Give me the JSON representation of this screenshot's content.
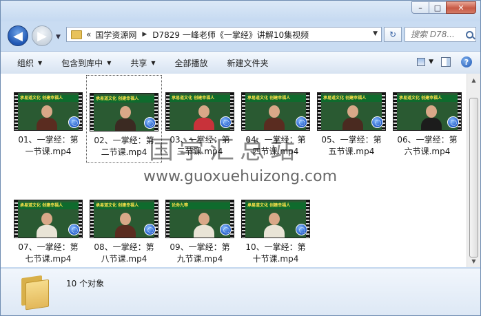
{
  "window": {
    "caption_buttons": {
      "minimize": "–",
      "maximize": "□",
      "close": "✕"
    }
  },
  "navigation": {
    "back_label": "◀",
    "forward_label": "▶",
    "address_prefix": "«",
    "breadcrumbs": [
      "国学资源网",
      "D7829 一峰老师《一掌经》讲解10集视频"
    ],
    "refresh_label": "↻",
    "search_placeholder": "搜索 D78..."
  },
  "toolbar": {
    "items": [
      {
        "label": "组织",
        "has_dropdown": true
      },
      {
        "label": "包含到库中",
        "has_dropdown": true
      },
      {
        "label": "共享",
        "has_dropdown": true
      },
      {
        "label": "全部播放",
        "has_dropdown": false
      },
      {
        "label": "新建文件夹",
        "has_dropdown": false
      }
    ],
    "right_icons": [
      "view-options-icon",
      "preview-pane-icon",
      "help-icon"
    ],
    "help_label": "?"
  },
  "files": [
    {
      "line1": "01、一掌经：第",
      "line2": "一节课.mp4",
      "banner": "承易道文化 创建幸福人",
      "shirt": "#5a2c20",
      "selected": false
    },
    {
      "line1": "02、一掌经：第",
      "line2": "二节课.mp4",
      "banner": "承易道文化 创建幸福人",
      "shirt": "#3b2a22",
      "selected": true
    },
    {
      "line1": "03、一掌经：第",
      "line2": "三节课.mp4",
      "banner": "承易道文化 创建幸福人",
      "shirt": "#c8323a",
      "selected": false
    },
    {
      "line1": "04、一掌经：第",
      "line2": "四节课.mp4",
      "banner": "承易道文化 创建幸福人",
      "shirt": "#5a2c20",
      "selected": false
    },
    {
      "line1": "05、一掌经：第",
      "line2": "五节课.mp4",
      "banner": "承易道文化 创建幸福人",
      "shirt": "#4a2a20",
      "selected": false
    },
    {
      "line1": "06、一掌经：第",
      "line2": "六节课.mp4",
      "banner": "承易道文化 创建幸福人",
      "shirt": "#1c1c1c",
      "selected": false
    },
    {
      "line1": "07、一掌经：第",
      "line2": "七节课.mp4",
      "banner": "承易道文化 创建幸福人",
      "shirt": "#e9e4d6",
      "selected": false
    },
    {
      "line1": "08、一掌经：第",
      "line2": "八节课.mp4",
      "banner": "承易道文化 创建幸福人",
      "shirt": "#5a2c20",
      "selected": false
    },
    {
      "line1": "09、一掌经：第",
      "line2": "九节课.mp4",
      "banner": "论命九等",
      "shirt": "#e9e4d6",
      "selected": false
    },
    {
      "line1": "10、一掌经：第",
      "line2": "十节课.mp4",
      "banner": "承易道文化 创建幸福人",
      "shirt": "#e9e4d6",
      "selected": false
    }
  ],
  "watermark": {
    "text": "国学汇总站",
    "url": "www.guoxuehuizong.com"
  },
  "status": {
    "count_text": "10 个对象"
  },
  "colors": {
    "accent": "#1e56b3",
    "toolbar_bg": "#e3ecf7",
    "thumb_green": "#0f6b2d"
  }
}
